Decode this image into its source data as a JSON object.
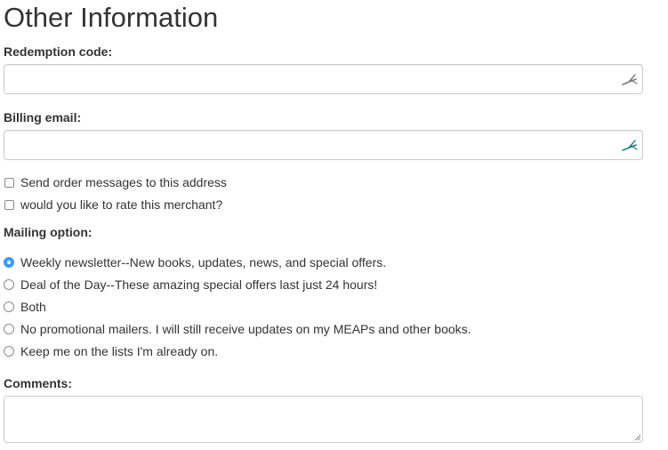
{
  "header": {
    "title": "Other Information"
  },
  "redemption": {
    "label": "Redemption code:",
    "value": "",
    "icon": "autofill-icon"
  },
  "billing_email": {
    "label": "Billing email:",
    "value": "",
    "icon": "autofill-icon"
  },
  "checkboxes": [
    {
      "label": "Send order messages to this address",
      "checked": false
    },
    {
      "label": "would you like to rate this merchant?",
      "checked": false
    }
  ],
  "mailing": {
    "label": "Mailing option:",
    "options": [
      {
        "label": "Weekly newsletter--New books, updates, news, and special offers.",
        "selected": true
      },
      {
        "label": "Deal of the Day--These amazing special offers last just 24 hours!",
        "selected": false
      },
      {
        "label": "Both",
        "selected": false
      },
      {
        "label": "No promotional mailers. I will still receive updates on my MEAPs and other books.",
        "selected": false
      },
      {
        "label": "Keep me on the lists I'm already on.",
        "selected": false
      }
    ]
  },
  "comments": {
    "label": "Comments:",
    "value": ""
  },
  "colors": {
    "text": "#333333",
    "border": "#cccccc",
    "radio_selected": "#3b99fc",
    "autofill_icon_grey": "#7a7a7a",
    "autofill_icon_teal": "#1a7f8e"
  }
}
